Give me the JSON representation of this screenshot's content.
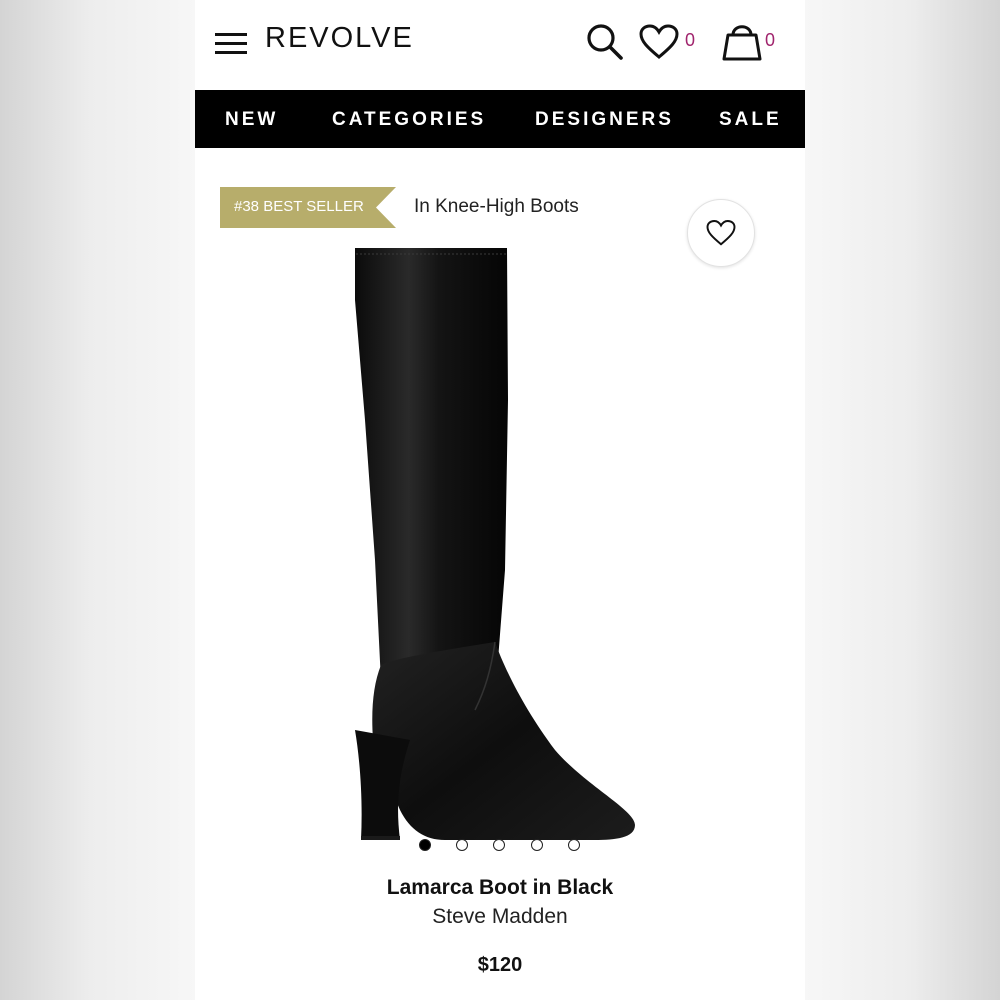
{
  "header": {
    "logo": "REVOLVE",
    "wishlist_count": "0",
    "bag_count": "0"
  },
  "nav": {
    "items": [
      "NEW",
      "CATEGORIES",
      "DESIGNERS",
      "SALE"
    ]
  },
  "badge": {
    "label": "#38 BEST SELLER",
    "category": "In Knee-High Boots"
  },
  "product": {
    "name": "Lamarca Boot in Black",
    "brand": "Steve Madden",
    "price": "$120",
    "image_count": 5,
    "active_image": 1
  },
  "colors": {
    "badge": "#b7ad6b",
    "count": "#a0246d",
    "nav_bg": "#000000"
  }
}
